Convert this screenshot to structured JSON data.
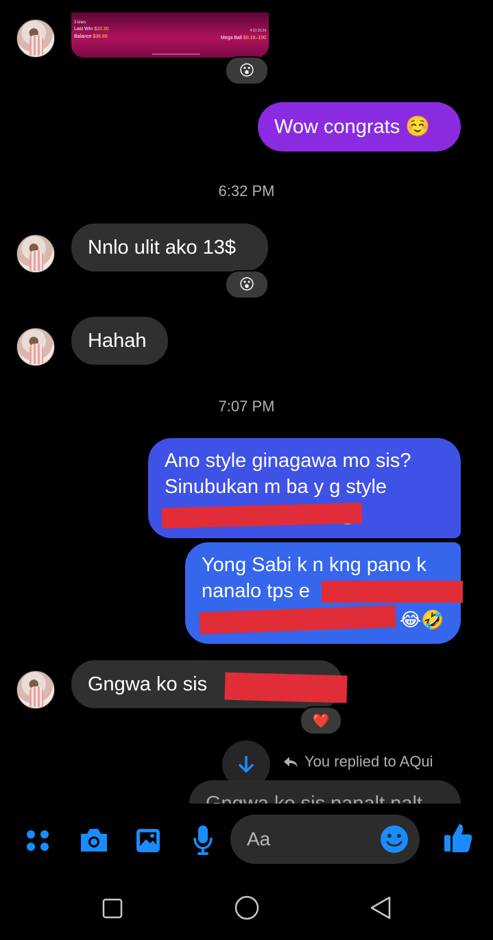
{
  "shared_image": {
    "lines_label": "3 lines",
    "last_win_label": "Last Win",
    "last_win_value": "$10.30",
    "balance_label": "Balance",
    "balance_value": "$38.89",
    "mega_ball_label": "Mega Ball",
    "mega_ball_value": "$0.10–100",
    "time_text": "4:10:15:34"
  },
  "messages": {
    "reaction_1": "😮",
    "out_1": "Wow congrats ☺️",
    "time_1": "6:32 PM",
    "in_1": "Nnlo ulit ako 13$",
    "reaction_2": "😮",
    "in_2": "Hahah",
    "time_2": "7:07 PM",
    "out_2_line1": "Ano style ginagawa mo sis?",
    "out_2_line2": "Sinubukan m ba y g style",
    "out_3_line1": "Yong Sabi k n kng pano k",
    "out_3_line2": "nanalo tps e",
    "out_3_emoji": "😂🤣",
    "in_3": "Gngwa ko sis",
    "reaction_3": "❤️",
    "reply_label": "You replied to AQui",
    "reply_preview": "Gngwa ko sis nanalt nalt"
  },
  "composer": {
    "placeholder": "Aa"
  },
  "colors": {
    "purple_bubble": "#8a2be2",
    "blue_bubble": "#3b5be8",
    "incoming_bubble": "#303030",
    "accent": "#1a8cff",
    "redaction": "#e02d38"
  },
  "icons": [
    "apps-icon",
    "camera-icon",
    "gallery-icon",
    "mic-icon",
    "emoji-icon",
    "thumbs-up-icon",
    "scroll-down-icon",
    "reply-arrow-icon",
    "nav-square-icon",
    "nav-circle-icon",
    "nav-back-icon"
  ]
}
